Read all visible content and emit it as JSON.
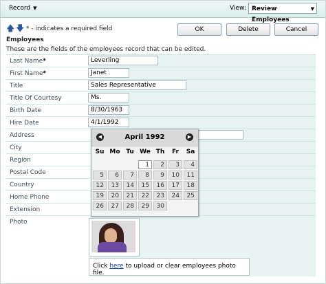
{
  "toolbar": {
    "record_menu": "Record",
    "view_label": "View:",
    "view_value": "Review Employees"
  },
  "actions": {
    "required_note": "* - indicates a required field",
    "ok": "OK",
    "delete": "Delete",
    "cancel": "Cancel"
  },
  "section": {
    "title": "Employees",
    "description": "These are the fields of the employees record that can be edited."
  },
  "fields": [
    {
      "label": "Last Name",
      "required": true,
      "value": "Leverling"
    },
    {
      "label": "First Name",
      "required": true,
      "value": "Janet"
    },
    {
      "label": "Title",
      "required": false,
      "value": "Sales Representative"
    },
    {
      "label": "Title Of Courtesy",
      "required": false,
      "value": "Ms."
    },
    {
      "label": "Birth Date",
      "required": false,
      "value": "8/30/1963"
    },
    {
      "label": "Hire Date",
      "required": false,
      "value": "4/1/1992"
    },
    {
      "label": "Address",
      "required": false,
      "value": ""
    },
    {
      "label": "City",
      "required": false,
      "value": ""
    },
    {
      "label": "Region",
      "required": false,
      "value": ""
    },
    {
      "label": "Postal Code",
      "required": false,
      "value": ""
    },
    {
      "label": "Country",
      "required": false,
      "value": ""
    },
    {
      "label": "Home Phone",
      "required": false,
      "value": ""
    },
    {
      "label": "Extension",
      "required": false,
      "value": ""
    },
    {
      "label": "Photo",
      "required": false,
      "value": ""
    }
  ],
  "photo": {
    "note_prefix": "Click ",
    "note_link": "here",
    "note_suffix": " to upload or clear employees photo file."
  },
  "calendar": {
    "month_title": "April 1992",
    "weekdays": [
      "Su",
      "Mo",
      "Tu",
      "We",
      "Th",
      "Fr",
      "Sa"
    ],
    "weeks": [
      [
        "",
        "",
        "",
        "1",
        "2",
        "3",
        "4"
      ],
      [
        "5",
        "6",
        "7",
        "8",
        "9",
        "10",
        "11"
      ],
      [
        "12",
        "13",
        "14",
        "15",
        "16",
        "17",
        "18"
      ],
      [
        "19",
        "20",
        "21",
        "22",
        "23",
        "24",
        "25"
      ],
      [
        "26",
        "27",
        "28",
        "29",
        "30",
        "",
        ""
      ]
    ],
    "selected_day": "1"
  },
  "icons": {
    "nav_up": "arrow-up-icon",
    "nav_down": "arrow-down-icon",
    "prev_month": "chevron-left-icon",
    "next_month": "chevron-right-icon"
  },
  "colors": {
    "row_value_bg": "#e6f3f1",
    "link": "#1a46b8"
  }
}
